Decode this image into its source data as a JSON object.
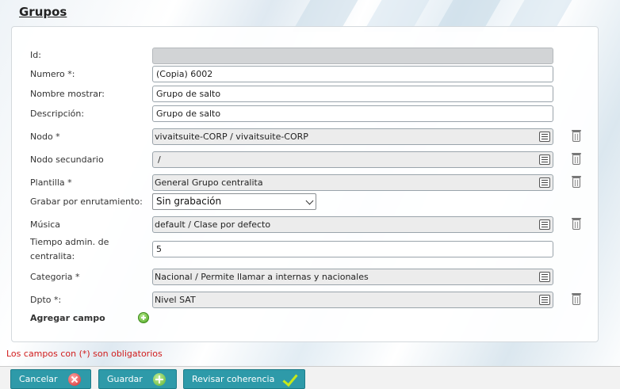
{
  "page": {
    "title": "Grupos"
  },
  "form": {
    "fields": [
      {
        "key": "id",
        "label": "Id:",
        "value": "",
        "type": "disabled"
      },
      {
        "key": "numero",
        "label": "Numero *:",
        "value": "(Copia) 6002",
        "type": "text"
      },
      {
        "key": "nombre",
        "label": "Nombre mostrar:",
        "value": "Grupo de salto",
        "type": "text"
      },
      {
        "key": "descripcion",
        "label": "Descripción:",
        "value": "Grupo de salto",
        "type": "text"
      },
      {
        "key": "nodo",
        "label": "Nodo *",
        "value": "vivaitsuite-CORP / vivaitsuite-CORP",
        "type": "lookup",
        "list_icon": "list-icon",
        "delete_icon": "trash-icon"
      },
      {
        "key": "nodo_secundario",
        "label": "Nodo secundario",
        "value": "/",
        "type": "lookup",
        "list_icon": "list-icon",
        "delete_icon": "trash-icon"
      },
      {
        "key": "plantilla",
        "label": "Plantilla *",
        "value": "General Grupo centralita",
        "type": "lookup",
        "list_icon": "list-icon",
        "delete_icon": "trash-icon"
      },
      {
        "key": "grabar",
        "label": "Grabar por enrutamiento:",
        "value": "Sin grabación",
        "type": "select"
      },
      {
        "key": "musica",
        "label": "Música",
        "value": "default / Clase por defecto",
        "type": "lookup",
        "list_icon": "list-icon",
        "delete_icon": "trash-icon"
      },
      {
        "key": "tiempo",
        "label_line1": "Tiempo admin. de",
        "label_line2": "centralita:",
        "value": "5",
        "type": "text"
      },
      {
        "key": "categoria",
        "label": "Categoria *",
        "value": "Nacional / Permite llamar a internas y nacionales",
        "type": "lookup",
        "list_icon": "list-icon"
      },
      {
        "key": "dpto",
        "label": "Dpto *:",
        "value": "Nivel SAT",
        "type": "lookup",
        "list_icon": "list-icon",
        "delete_icon": "trash-icon"
      }
    ],
    "add_field": {
      "label": "Agregar campo",
      "icon": "add-circle-icon"
    }
  },
  "required_note": "Los campos con (*) son obligatorios",
  "buttons": {
    "cancel": {
      "label": "Cancelar",
      "icon": "cancel-x-icon"
    },
    "save": {
      "label": "Guardar",
      "icon": "plus-icon"
    },
    "review": {
      "label": "Revisar coherencia",
      "icon": "checkmark-icon"
    }
  },
  "colors": {
    "button_bg": "#2e9aa9",
    "required_text": "#d01b1b",
    "disabled_field": "#d2d4d6"
  }
}
